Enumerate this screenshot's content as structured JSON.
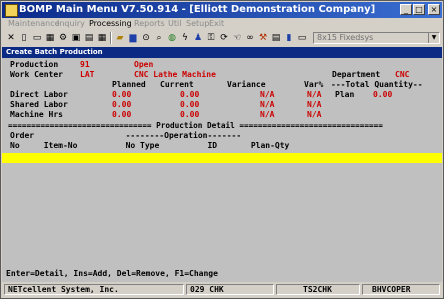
{
  "window": {
    "title": "BOMP Main Menu V7.50.914 - [Elliott Demonstration Company]"
  },
  "menu": [
    {
      "label": "Maintenance",
      "active": false
    },
    {
      "label": "Inquiry",
      "active": false
    },
    {
      "label": "Processing",
      "active": true
    },
    {
      "label": "Reports",
      "active": false
    },
    {
      "label": "Util",
      "active": false
    },
    {
      "label": "Setup",
      "active": false
    },
    {
      "label": "Exit",
      "active": false
    }
  ],
  "toolbar": {
    "font_select": "8x15 Fixedsys"
  },
  "screen": {
    "title": "Create Batch Production"
  },
  "form": {
    "production_label": "Production",
    "production_no": "91",
    "production_status": "Open",
    "work_center_label": "Work Center",
    "work_center_code": "LAT",
    "work_center_name": "CNC Lathe Machine",
    "department_label": "Department",
    "department_value": "CNC",
    "columns": {
      "planned": "Planned",
      "current": "Current",
      "variance": "Variance",
      "var_pct": "Var%",
      "total_qty": "---Total Quantity--"
    },
    "rows": [
      {
        "label": "Direct Labor",
        "planned": "0.00",
        "current": "0.00",
        "variance": "N/A",
        "var_pct": "N/A"
      },
      {
        "label": "Shared Labor",
        "planned": "0.00",
        "current": "0.00",
        "variance": "N/A",
        "var_pct": "N/A"
      },
      {
        "label": "Machine Hrs",
        "planned": "0.00",
        "current": "0.00",
        "variance": "N/A",
        "var_pct": "N/A"
      }
    ],
    "plan_label": "Plan",
    "plan_value": "0.00"
  },
  "detail": {
    "title_line": "=============================== Production Detail ===============================",
    "header1": "Order                   --------Operation-------",
    "header2": "No     Item-No          No Type          ID       Plan-Qty"
  },
  "help_line": "Enter=Detail, Ins=Add, Del=Remove, F1=Change",
  "status": {
    "company": "NETcellent System, Inc.",
    "code1": "029 CHK",
    "code2": "TS2CHK",
    "code3": "BHVCOPER"
  }
}
